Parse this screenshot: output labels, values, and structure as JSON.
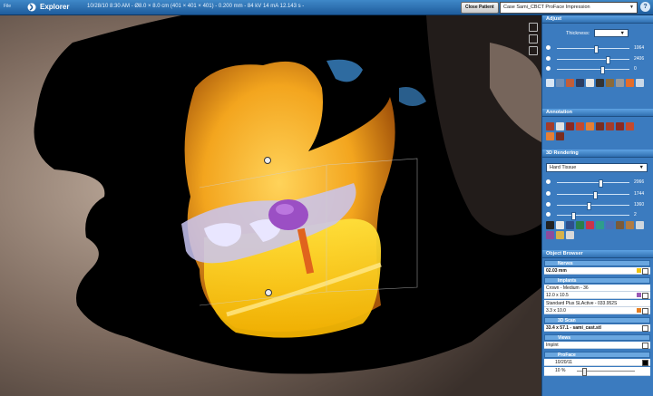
{
  "titlebar": {
    "file": "File",
    "app": "Explorer",
    "scan_info": "10/28/10 8:30 AM - Ø8.0 × 8.0 cm (401 × 401 × 401) - 0.200 mm - 84 kV 14 mA 12.143 s -",
    "close_button": "Close Patient",
    "case": "Case Sami_CBCT ProFace Impression",
    "help": "?"
  },
  "adjust": {
    "title": "Adjust",
    "thickness_label": "Thickness:",
    "thickness_value": "",
    "sliders": [
      {
        "value": "1064",
        "level": 0.52
      },
      {
        "value": "2406",
        "level": 0.68
      },
      {
        "value": "0",
        "level": 0.6
      }
    ]
  },
  "annotation": {
    "title": "Annotation"
  },
  "rendering": {
    "title": "3D Rendering",
    "preset": "Hard Tissue",
    "sliders": [
      {
        "value": "2066",
        "level": 0.58
      },
      {
        "value": "1744",
        "level": 0.5
      },
      {
        "value": "1360",
        "level": 0.42
      },
      {
        "value": "2",
        "level": 0.2
      }
    ]
  },
  "objects": {
    "title": "Object Browser",
    "nerves_header": "Nerves",
    "nerve_item": "02.03 mm",
    "implants_header": "Implants",
    "implant_items": [
      "Crown - Medium - 36",
      "12.0 x 10.5",
      "Standard Plus SLActive - 033.952S",
      "3.3 x 10.0"
    ],
    "scans_header": "3D Scan",
    "scan_item": "33.4 x 57.1 - sami_cast.stl",
    "views_header": "Views",
    "view_item": "Implnt",
    "proface_header": "ProFace",
    "proface_date": "10/20/11",
    "proface_opacity": "10 %"
  }
}
